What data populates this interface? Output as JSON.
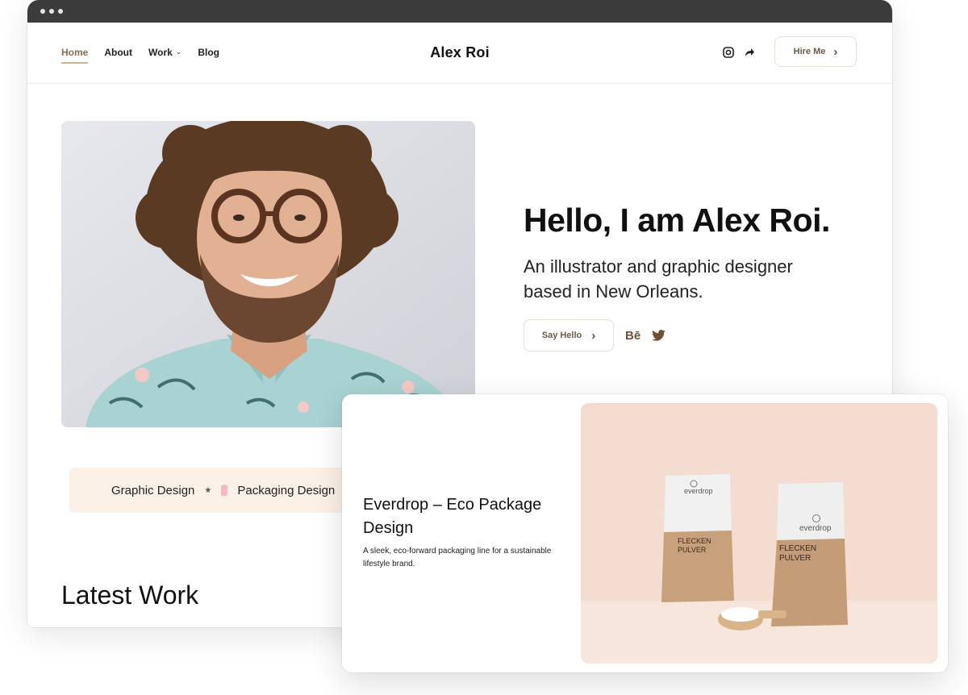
{
  "nav": {
    "links": [
      {
        "label": "Home"
      },
      {
        "label": "About"
      },
      {
        "label": "Work"
      },
      {
        "label": "Blog"
      }
    ],
    "brand": "Alex Roi",
    "hire_label": "Hire Me"
  },
  "hero": {
    "title": "Hello, I am Alex Roi.",
    "subtitle_line1": "An illustrator and graphic designer",
    "subtitle_line2": "based in New Orleans.",
    "say_hello_label": "Say Hello",
    "behance_label": "Bē"
  },
  "categories": [
    {
      "label": "Graphic Design"
    },
    {
      "label": "Packaging Design"
    }
  ],
  "latest_heading": "Latest Work",
  "card": {
    "title": "Everdrop – Eco Package Design",
    "description": "A sleek, eco-forward packaging line for a sustainable lifestyle brand.",
    "package_brand": "everdrop",
    "package_line1": "FLECKEN",
    "package_line2": "PULVER"
  },
  "colors": {
    "accent": "#8a6d4a",
    "cat_bg": "#fbf1e7",
    "image_bg": "#f4ddd0"
  },
  "icons": [
    "instagram-icon",
    "share-icon",
    "chevron-right-icon",
    "behance-icon",
    "twitter-icon",
    "star-icon",
    "bottle-icon"
  ]
}
